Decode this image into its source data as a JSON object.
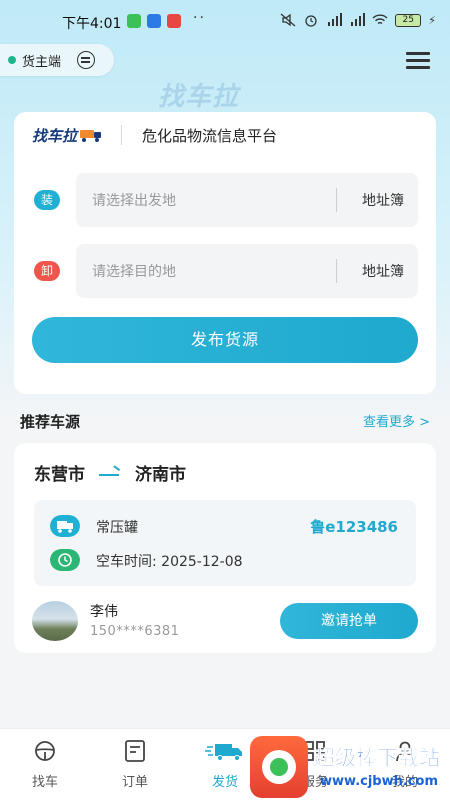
{
  "status_bar": {
    "time": "下午4:01",
    "battery": "25"
  },
  "header": {
    "role_label": "货主端",
    "watermark_logo": "找车拉"
  },
  "brand": {
    "logo_text": "找车拉",
    "tagline": "危化品物流信息平台"
  },
  "form": {
    "load_badge": "装",
    "unload_badge": "卸",
    "origin_placeholder": "请选择出发地",
    "destination_placeholder": "请选择目的地",
    "address_book_label": "地址簿",
    "publish_label": "发布货源",
    "colors": {
      "load_badge": "#1fb0d4",
      "unload_badge": "#f0554c",
      "accent": "#1fa9cf"
    }
  },
  "recommend": {
    "title": "推荐车源",
    "more_label": "查看更多 >",
    "vehicle": {
      "from": "东营市",
      "to": "济南市",
      "truck_type": "常压罐",
      "plate": "鲁e123486",
      "empty_time": "空车时间: 2025-12-08",
      "driver_name": "李伟",
      "driver_phone": "150****6381",
      "invite_label": "邀请抢单"
    }
  },
  "tabs": [
    {
      "label": "找车",
      "icon": "steering-wheel-icon"
    },
    {
      "label": "订单",
      "icon": "order-list-icon"
    },
    {
      "label": "发货",
      "icon": "delivery-truck-icon",
      "active": true
    },
    {
      "label": "服务",
      "icon": "grid-service-icon"
    },
    {
      "label": "我的",
      "icon": "user-icon"
    }
  ],
  "site_badge": {
    "name": "超级棒下载站",
    "url": "www.cjbwh.com"
  }
}
